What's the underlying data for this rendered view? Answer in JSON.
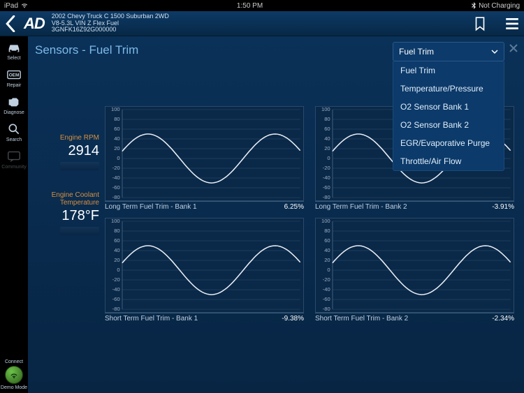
{
  "status": {
    "carrier": "iPad",
    "time": "1:50 PM",
    "battery": "Not Charging"
  },
  "header": {
    "logo": "AD",
    "vehicle_line1": "2002 Chevy Truck C 1500 Suburban 2WD",
    "vehicle_line2": "V8-5.3L VIN Z Flex Fuel",
    "vehicle_line3": "3GNFK16Z92G000000"
  },
  "sidebar": {
    "items": [
      {
        "label": "Select",
        "icon": "car"
      },
      {
        "label": "Repair",
        "icon": "oem"
      },
      {
        "label": "Diagnose",
        "icon": "engine"
      },
      {
        "label": "Search",
        "icon": "search"
      },
      {
        "label": "Community",
        "icon": "chat",
        "dim": true
      }
    ],
    "connect_label": "Connect",
    "demo_label": "Demo Mode"
  },
  "page": {
    "title": "Sensors - Fuel Trim"
  },
  "dropdown": {
    "selected": "Fuel Trim",
    "options": [
      "Fuel Trim",
      "Temperature/Pressure",
      "O2 Sensor Bank 1",
      "O2 Sensor Bank 2",
      "EGR/Evaporative Purge",
      "Throttle/Air Flow"
    ]
  },
  "gauges": [
    {
      "label": "Engine RPM",
      "value": "2914"
    },
    {
      "label": "Engine Coolant Temperature",
      "value": "178°F"
    }
  ],
  "chart_data": [
    {
      "type": "line",
      "title": "Long Term Fuel Trim - Bank 1",
      "current": "6.25%",
      "ylim": [
        -80,
        100
      ],
      "yticks": [
        100,
        80,
        60,
        40,
        20,
        0,
        -20,
        -40,
        -60,
        -80
      ],
      "amplitude": 50,
      "offset": 0,
      "cycles": 1.4
    },
    {
      "type": "line",
      "title": "Long Term Fuel Trim - Bank 2",
      "current": "-3.91%",
      "ylim": [
        -80,
        100
      ],
      "yticks": [
        100,
        80,
        60,
        40,
        20,
        0,
        -20,
        -40,
        -60,
        -80
      ],
      "amplitude": 50,
      "offset": 0,
      "cycles": 1.4
    },
    {
      "type": "line",
      "title": "Short Term Fuel Trim - Bank 1",
      "current": "-9.38%",
      "ylim": [
        -80,
        100
      ],
      "yticks": [
        100,
        80,
        60,
        40,
        20,
        0,
        -20,
        -40,
        -60,
        -80
      ],
      "amplitude": 50,
      "offset": 0,
      "cycles": 1.4
    },
    {
      "type": "line",
      "title": "Short Term Fuel Trim - Bank 2",
      "current": "-2.34%",
      "ylim": [
        -80,
        100
      ],
      "yticks": [
        100,
        80,
        60,
        40,
        20,
        0,
        -20,
        -40,
        -60,
        -80
      ],
      "amplitude": 50,
      "offset": 0,
      "cycles": 1.4
    }
  ]
}
